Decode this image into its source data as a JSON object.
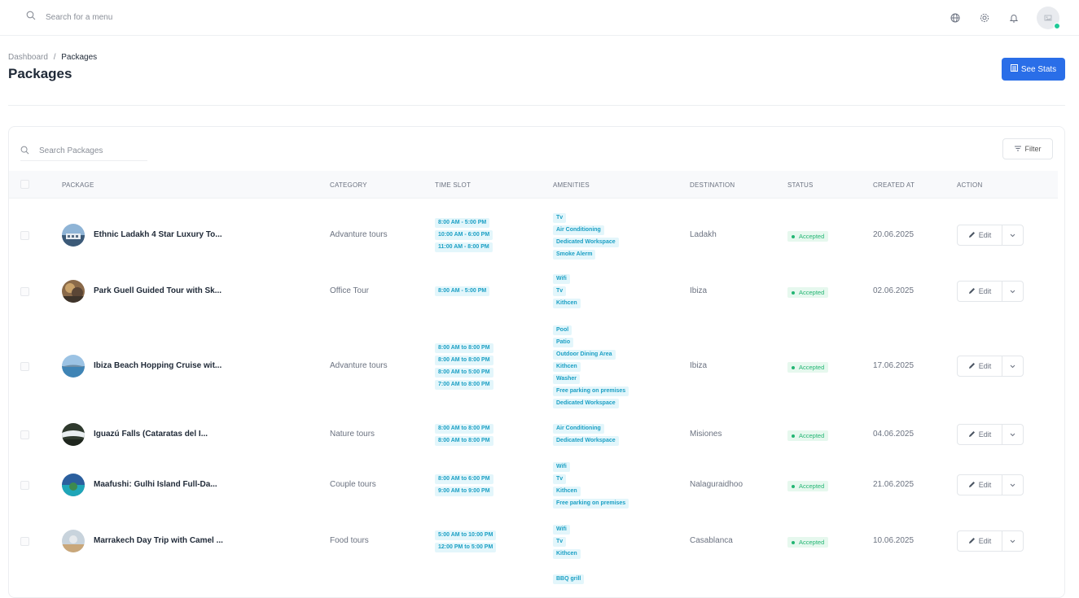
{
  "topbar": {
    "search_placeholder": "Search for a menu",
    "icons": [
      "globe-icon",
      "gear-icon",
      "bell-icon",
      "avatar"
    ]
  },
  "breadcrumb": {
    "root": "Dashboard",
    "sep": "/",
    "current": "Packages"
  },
  "page_title": "Packages",
  "see_stats_label": "See Stats",
  "table": {
    "search_placeholder": "Search Packages",
    "filter_label": "Filter",
    "columns": [
      "PACKAGE",
      "CATEGORY",
      "TIME SLOT",
      "AMENITIES",
      "DESTINATION",
      "STATUS",
      "CREATED AT",
      "ACTION"
    ],
    "edit_label": "Edit",
    "rows": [
      {
        "name": "Ethnic Ladakh 4 Star Luxury To...",
        "category": "Advanture tours",
        "time_slots": [
          "8:00 AM - 5:00 PM",
          "10:00 AM - 6:00 PM",
          "11:00 AM - 8:00 PM"
        ],
        "amenities": [
          "Tv",
          "Air Conditioning",
          "Dedicated Workspace",
          "Smoke Alerm"
        ],
        "destination": "Ladakh",
        "status": "Accepted",
        "created": "20.06.2025"
      },
      {
        "name": "Park Guell Guided Tour with Sk...",
        "category": "Office Tour",
        "time_slots": [
          "8:00 AM - 5:00 PM"
        ],
        "amenities": [
          "Wifi",
          "Tv",
          "Kithcen"
        ],
        "destination": "Ibiza",
        "status": "Accepted",
        "created": "02.06.2025"
      },
      {
        "name": "Ibiza Beach Hopping Cruise wit...",
        "category": "Advanture tours",
        "time_slots": [
          "8:00 AM to 8:00 PM",
          "8:00 AM to 8:00 PM",
          "8:00 AM to 5:00 PM",
          "7:00 AM to 8:00 PM"
        ],
        "amenities": [
          "Pool",
          "Patio",
          "Outdoor Dining Area",
          "Kithcen",
          "Washer",
          "Free parking on premises",
          "Dedicated Workspace"
        ],
        "destination": "Ibiza",
        "status": "Accepted",
        "created": "17.06.2025"
      },
      {
        "name": "Iguazú Falls (Cataratas del I...",
        "category": "Nature tours",
        "time_slots": [
          "8:00 AM to 8:00 PM",
          "8:00 AM to 8:00 PM"
        ],
        "amenities": [
          "Air Conditioning",
          "Dedicated Workspace"
        ],
        "destination": "Misiones",
        "status": "Accepted",
        "created": "04.06.2025"
      },
      {
        "name": "Maafushi: Gulhi Island Full-Da...",
        "category": "Couple tours",
        "time_slots": [
          "8:00 AM to 6:00 PM",
          "9:00 AM to 9:00 PM"
        ],
        "amenities": [
          "Wifi",
          "Tv",
          "Kithcen",
          "Free parking on premises"
        ],
        "destination": "Nalaguraidhoo",
        "status": "Accepted",
        "created": "21.06.2025"
      },
      {
        "name": "Marrakech Day Trip with Camel ...",
        "category": "Food tours",
        "time_slots": [
          "5:00 AM to 10:00 PM",
          "12:00 PM to 5:00 PM"
        ],
        "amenities": [
          "Wifi",
          "Tv",
          "Kithcen"
        ],
        "destination": "Casablanca",
        "status": "Accepted",
        "created": "10.06.2025"
      }
    ],
    "partial_next_chip": "BBQ grill"
  },
  "colors": {
    "primary": "#2a6ee8",
    "chip_bg": "#e3f6fb",
    "chip_text": "#1a9fc4",
    "accepted": "#22b573"
  }
}
